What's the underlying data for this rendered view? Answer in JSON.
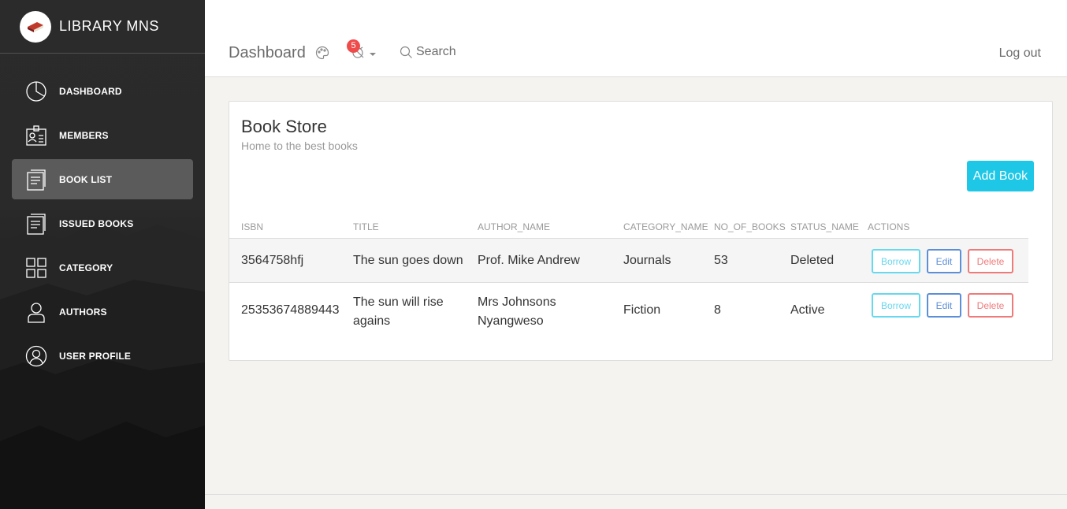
{
  "app": {
    "title": "LIBRARY MNS"
  },
  "sidebar": {
    "items": [
      {
        "label": "DASHBOARD",
        "icon": "pie-chart-icon",
        "active": false
      },
      {
        "label": "MEMBERS",
        "icon": "id-card-icon",
        "active": false
      },
      {
        "label": "BOOK LIST",
        "icon": "document-list-icon",
        "active": true
      },
      {
        "label": "ISSUED BOOKS",
        "icon": "document-list-icon",
        "active": false
      },
      {
        "label": "CATEGORY",
        "icon": "grid-icon",
        "active": false
      },
      {
        "label": "AUTHORS",
        "icon": "user-icon",
        "active": false
      },
      {
        "label": "USER PROFILE",
        "icon": "user-circle-icon",
        "active": false
      }
    ]
  },
  "header": {
    "brand": "Dashboard",
    "notification_count": "5",
    "search_label": "Search",
    "logout_label": "Log out"
  },
  "card": {
    "title": "Book Store",
    "subtitle": "Home to the best books",
    "add_button": "Add Book"
  },
  "table": {
    "columns": [
      "ISBN",
      "TITLE",
      "AUTHOR_NAME",
      "CATEGORY_NAME",
      "NO_OF_BOOKS",
      "STATUS_NAME",
      "ACTIONS"
    ],
    "rows": [
      {
        "isbn": "3564758hfj",
        "title_1": "The sun goes down",
        "title_2": "",
        "author_1": "Prof. Mike Andrew",
        "author_2": "",
        "category": "Journals",
        "count": "53",
        "status": "Deleted"
      },
      {
        "isbn": "25353674889443",
        "title_1": "The sun will rise",
        "title_2": "agains",
        "author_1": "Mrs Johnsons",
        "author_2": "Nyangweso",
        "category": "Fiction",
        "count": "8",
        "status": "Active"
      }
    ],
    "actions": {
      "borrow": "Borrow",
      "edit": "Edit",
      "delete": "Delete"
    }
  },
  "colors": {
    "accent": "#1ec7e6",
    "edit": "#5d8fd9",
    "delete": "#ef7a7a",
    "badge": "#ef4b4b"
  }
}
